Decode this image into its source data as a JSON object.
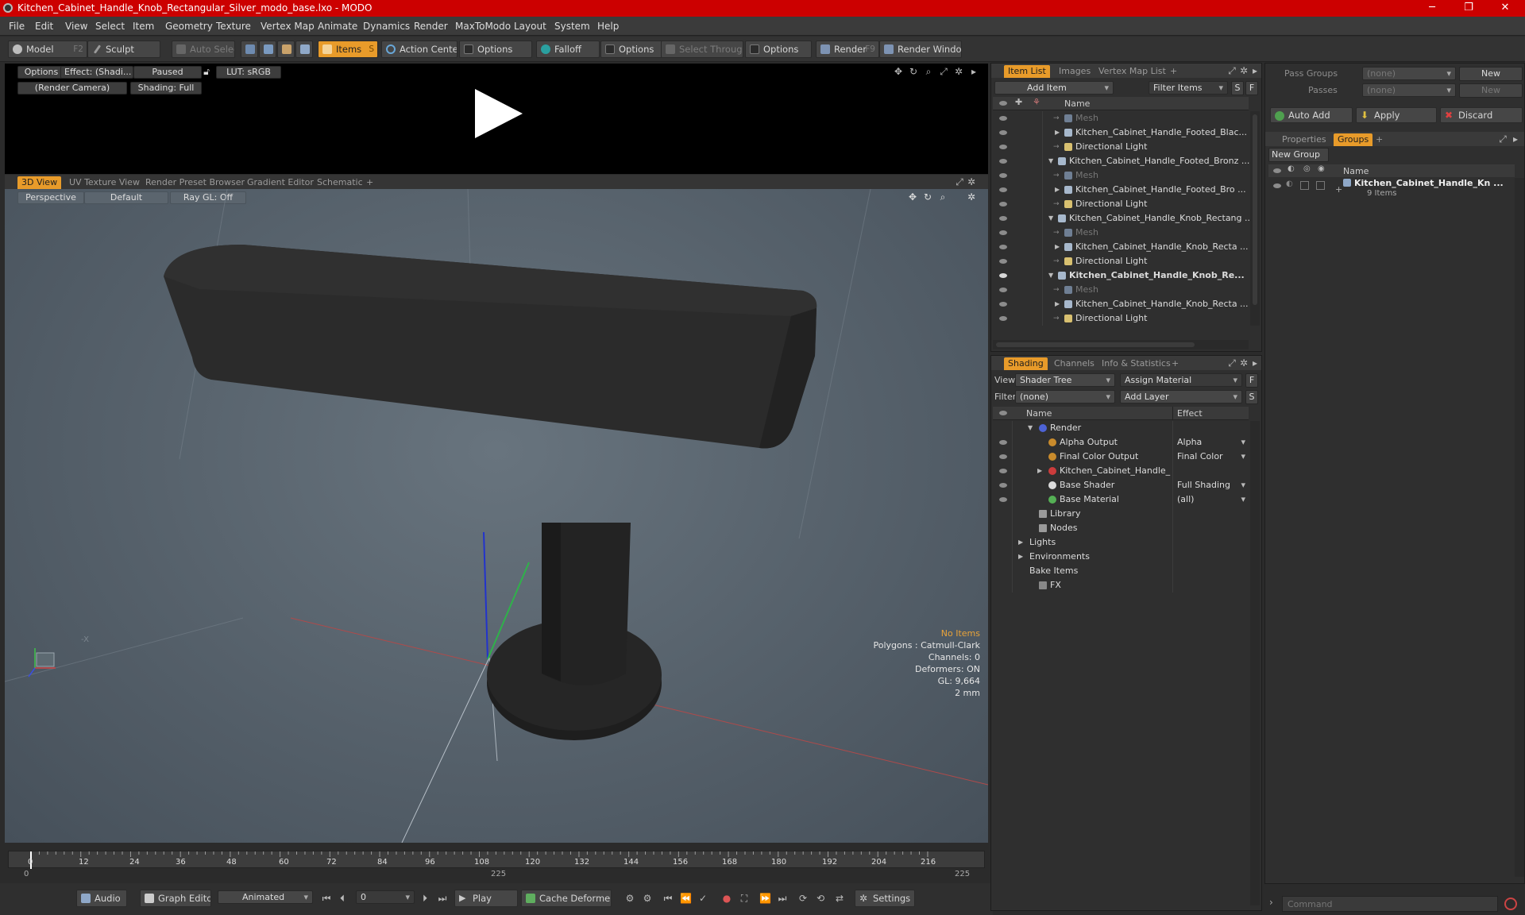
{
  "window": {
    "title": "Kitchen_Cabinet_Handle_Knob_Rectangular_Silver_modo_base.lxo - MODO",
    "minimize": "─",
    "maximize": "❐",
    "close": "✕"
  },
  "menu": [
    "File",
    "Edit",
    "View",
    "Select",
    "Item",
    "Geometry",
    "Texture",
    "Vertex Map",
    "Animate",
    "Dynamics",
    "Render",
    "MaxToModo",
    "Layout",
    "System",
    "Help"
  ],
  "toolbar": {
    "model": "Model",
    "model_key": "F2",
    "sculpt": "Sculpt",
    "auto_select": "Auto Select",
    "items": "Items",
    "items_key": "S",
    "action_center": "Action Center",
    "options1": "Options",
    "falloff": "Falloff",
    "options2": "Options",
    "select_through": "Select Through",
    "options3": "Options",
    "render": "Render",
    "render_key": "F9",
    "render_window": "Render Window"
  },
  "preview": {
    "options": "Options",
    "effect": "Effect: (Shadi...",
    "paused": "Paused",
    "lut": "LUT: sRGB",
    "camera": "(Render Camera)",
    "shading": "Shading: Full"
  },
  "viewport_tabs": [
    "3D View",
    "UV Texture View",
    "Render Preset Browser",
    "Gradient Editor",
    "Schematic",
    "+"
  ],
  "viewport": {
    "perspective": "Perspective",
    "default": "Default",
    "raygl": "Ray GL: Off",
    "axis_label": "-X"
  },
  "stats": {
    "no_items": "No Items",
    "polygons": "Polygons : Catmull-Clark",
    "channels": "Channels: 0",
    "deformers": "Deformers: ON",
    "gl": "GL: 9,664",
    "size": "2 mm"
  },
  "timeline": {
    "ticks": [
      "0",
      "12",
      "24",
      "36",
      "48",
      "60",
      "72",
      "84",
      "96",
      "108",
      "120",
      "132",
      "144",
      "156",
      "168",
      "180",
      "192",
      "204",
      "216"
    ],
    "start": "0",
    "mid": "225",
    "end": "225"
  },
  "transport": {
    "audio": "Audio",
    "graph_editor": "Graph Editor",
    "animated": "Animated",
    "frame": "0",
    "play": "Play",
    "cache_deformers": "Cache Deformers",
    "settings": "Settings"
  },
  "itemlist": {
    "tabs": [
      "Item List",
      "Images",
      "Vertex Map List",
      "+"
    ],
    "add_item": "Add Item",
    "filter_items": "Filter Items",
    "s": "S",
    "f": "F",
    "col_name": "Name",
    "rows": [
      {
        "label": "Mesh",
        "indent": 3,
        "dim": true,
        "bold": false,
        "expander": ""
      },
      {
        "label": "Kitchen_Cabinet_Handle_Footed_Blac...",
        "indent": 3,
        "dim": false,
        "bold": false,
        "expander": "▶"
      },
      {
        "label": "Directional Light",
        "indent": 3,
        "dim": false,
        "bold": false,
        "expander": ""
      },
      {
        "label": "Kitchen_Cabinet_Handle_Footed_Bronz ...",
        "indent": 2,
        "dim": false,
        "bold": false,
        "expander": "▼"
      },
      {
        "label": "Mesh",
        "indent": 3,
        "dim": true,
        "bold": false,
        "expander": ""
      },
      {
        "label": "Kitchen_Cabinet_Handle_Footed_Bro ...",
        "indent": 3,
        "dim": false,
        "bold": false,
        "expander": "▶"
      },
      {
        "label": "Directional Light",
        "indent": 3,
        "dim": false,
        "bold": false,
        "expander": ""
      },
      {
        "label": "Kitchen_Cabinet_Handle_Knob_Rectang ...",
        "indent": 2,
        "dim": false,
        "bold": false,
        "expander": "▼"
      },
      {
        "label": "Mesh",
        "indent": 3,
        "dim": true,
        "bold": false,
        "expander": ""
      },
      {
        "label": "Kitchen_Cabinet_Handle_Knob_Recta ...",
        "indent": 3,
        "dim": false,
        "bold": false,
        "expander": "▶"
      },
      {
        "label": "Directional Light",
        "indent": 3,
        "dim": false,
        "bold": false,
        "expander": ""
      },
      {
        "label": "Kitchen_Cabinet_Handle_Knob_Re...",
        "indent": 2,
        "dim": false,
        "bold": true,
        "expander": "▼"
      },
      {
        "label": "Mesh",
        "indent": 3,
        "dim": true,
        "bold": false,
        "expander": ""
      },
      {
        "label": "Kitchen_Cabinet_Handle_Knob_Recta ...",
        "indent": 3,
        "dim": false,
        "bold": false,
        "expander": "▶"
      },
      {
        "label": "Directional Light",
        "indent": 3,
        "dim": false,
        "bold": false,
        "expander": ""
      }
    ]
  },
  "shading": {
    "tabs": [
      "Shading",
      "Channels",
      "Info & Statistics",
      "+"
    ],
    "view_label": "View",
    "view_value": "Shader Tree",
    "assign_material": "Assign Material",
    "filter_label": "Filter",
    "filter_value": "(none)",
    "add_layer": "Add Layer",
    "f": "F",
    "s": "S",
    "col_name": "Name",
    "col_effect": "Effect",
    "rows": [
      {
        "label": "Render",
        "effect": "",
        "indent": 1,
        "expander": "▼",
        "eye": false
      },
      {
        "label": "Alpha Output",
        "effect": "Alpha",
        "indent": 2,
        "expander": "",
        "eye": true
      },
      {
        "label": "Final Color Output",
        "effect": "Final Color",
        "indent": 2,
        "expander": "",
        "eye": true
      },
      {
        "label": "Kitchen_Cabinet_Handle_K...",
        "effect": "",
        "indent": 2,
        "expander": "▶",
        "eye": true
      },
      {
        "label": "Base Shader",
        "effect": "Full Shading",
        "indent": 2,
        "expander": "",
        "eye": true
      },
      {
        "label": "Base Material",
        "effect": "(all)",
        "indent": 2,
        "expander": "",
        "eye": true
      },
      {
        "label": "Library",
        "effect": "",
        "indent": 1,
        "expander": "",
        "eye": false
      },
      {
        "label": "Nodes",
        "effect": "",
        "indent": 1,
        "expander": "",
        "eye": false
      },
      {
        "label": "Lights",
        "effect": "",
        "indent": 0,
        "expander": "▶",
        "eye": false
      },
      {
        "label": "Environments",
        "effect": "",
        "indent": 0,
        "expander": "▶",
        "eye": false
      },
      {
        "label": "Bake Items",
        "effect": "",
        "indent": 0,
        "expander": "",
        "eye": false
      },
      {
        "label": "FX",
        "effect": "",
        "indent": 1,
        "expander": "",
        "eye": false
      }
    ]
  },
  "groups": {
    "pass_groups": "Pass Groups",
    "pass_value": "(none)",
    "new": "New",
    "passes": "Passes",
    "passes_value": "(none)",
    "new2": "New",
    "auto_add": "Auto Add",
    "apply": "Apply",
    "discard": "Discard",
    "tabs": [
      "Properties",
      "Groups",
      "+"
    ],
    "new_group": "New Group",
    "col_name": "Name",
    "item_name": "Kitchen_Cabinet_Handle_Kn ...",
    "item_count": "9 Items"
  },
  "command": {
    "placeholder": "Command"
  },
  "colors": {
    "accent": "#e89b2a",
    "title_red": "#cc0000",
    "stats_orange": "#e8a33a"
  }
}
